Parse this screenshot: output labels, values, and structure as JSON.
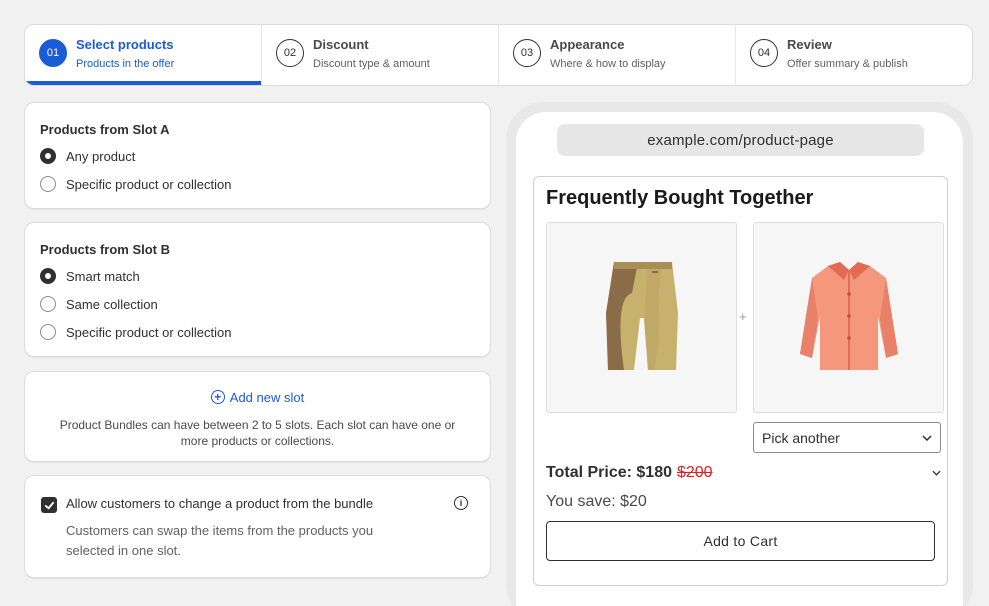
{
  "steps": [
    {
      "num": "01",
      "title": "Select products",
      "sub": "Products in the offer",
      "active": true
    },
    {
      "num": "02",
      "title": "Discount",
      "sub": "Discount type & amount"
    },
    {
      "num": "03",
      "title": "Appearance",
      "sub": "Where & how to display"
    },
    {
      "num": "04",
      "title": "Review",
      "sub": "Offer summary & publish"
    }
  ],
  "slot_a": {
    "title": "Products from Slot A",
    "options": [
      "Any product",
      "Specific product or collection"
    ],
    "selected": "Any product"
  },
  "slot_b": {
    "title": "Products from Slot B",
    "options": [
      "Smart match",
      "Same collection",
      "Specific product or collection"
    ],
    "selected": "Smart match"
  },
  "add_slot": {
    "label": "Add new slot",
    "help": "Product Bundles can have between 2 to 5 slots. Each slot can have one or more products or collections."
  },
  "allow_change": {
    "checked": true,
    "label": "Allow customers to change a product from the bundle",
    "help": "Customers can swap the items from the products you selected in one slot."
  },
  "preview": {
    "url": "example.com/product-page",
    "widget_title": "Frequently Bought Together",
    "plus": "+",
    "pick_label": "Pick another",
    "total_label": "Total Price: $180",
    "old_price": "$200",
    "save_label": "You save: $20",
    "cart_label": "Add to Cart"
  },
  "colors": {
    "accent": "#1a5bd8",
    "strike_price": "#e02020"
  },
  "icons": {
    "add": "plus-circle-icon",
    "info": "info-icon",
    "check": "checkmark-icon",
    "chevron": "chevron-down-icon"
  }
}
